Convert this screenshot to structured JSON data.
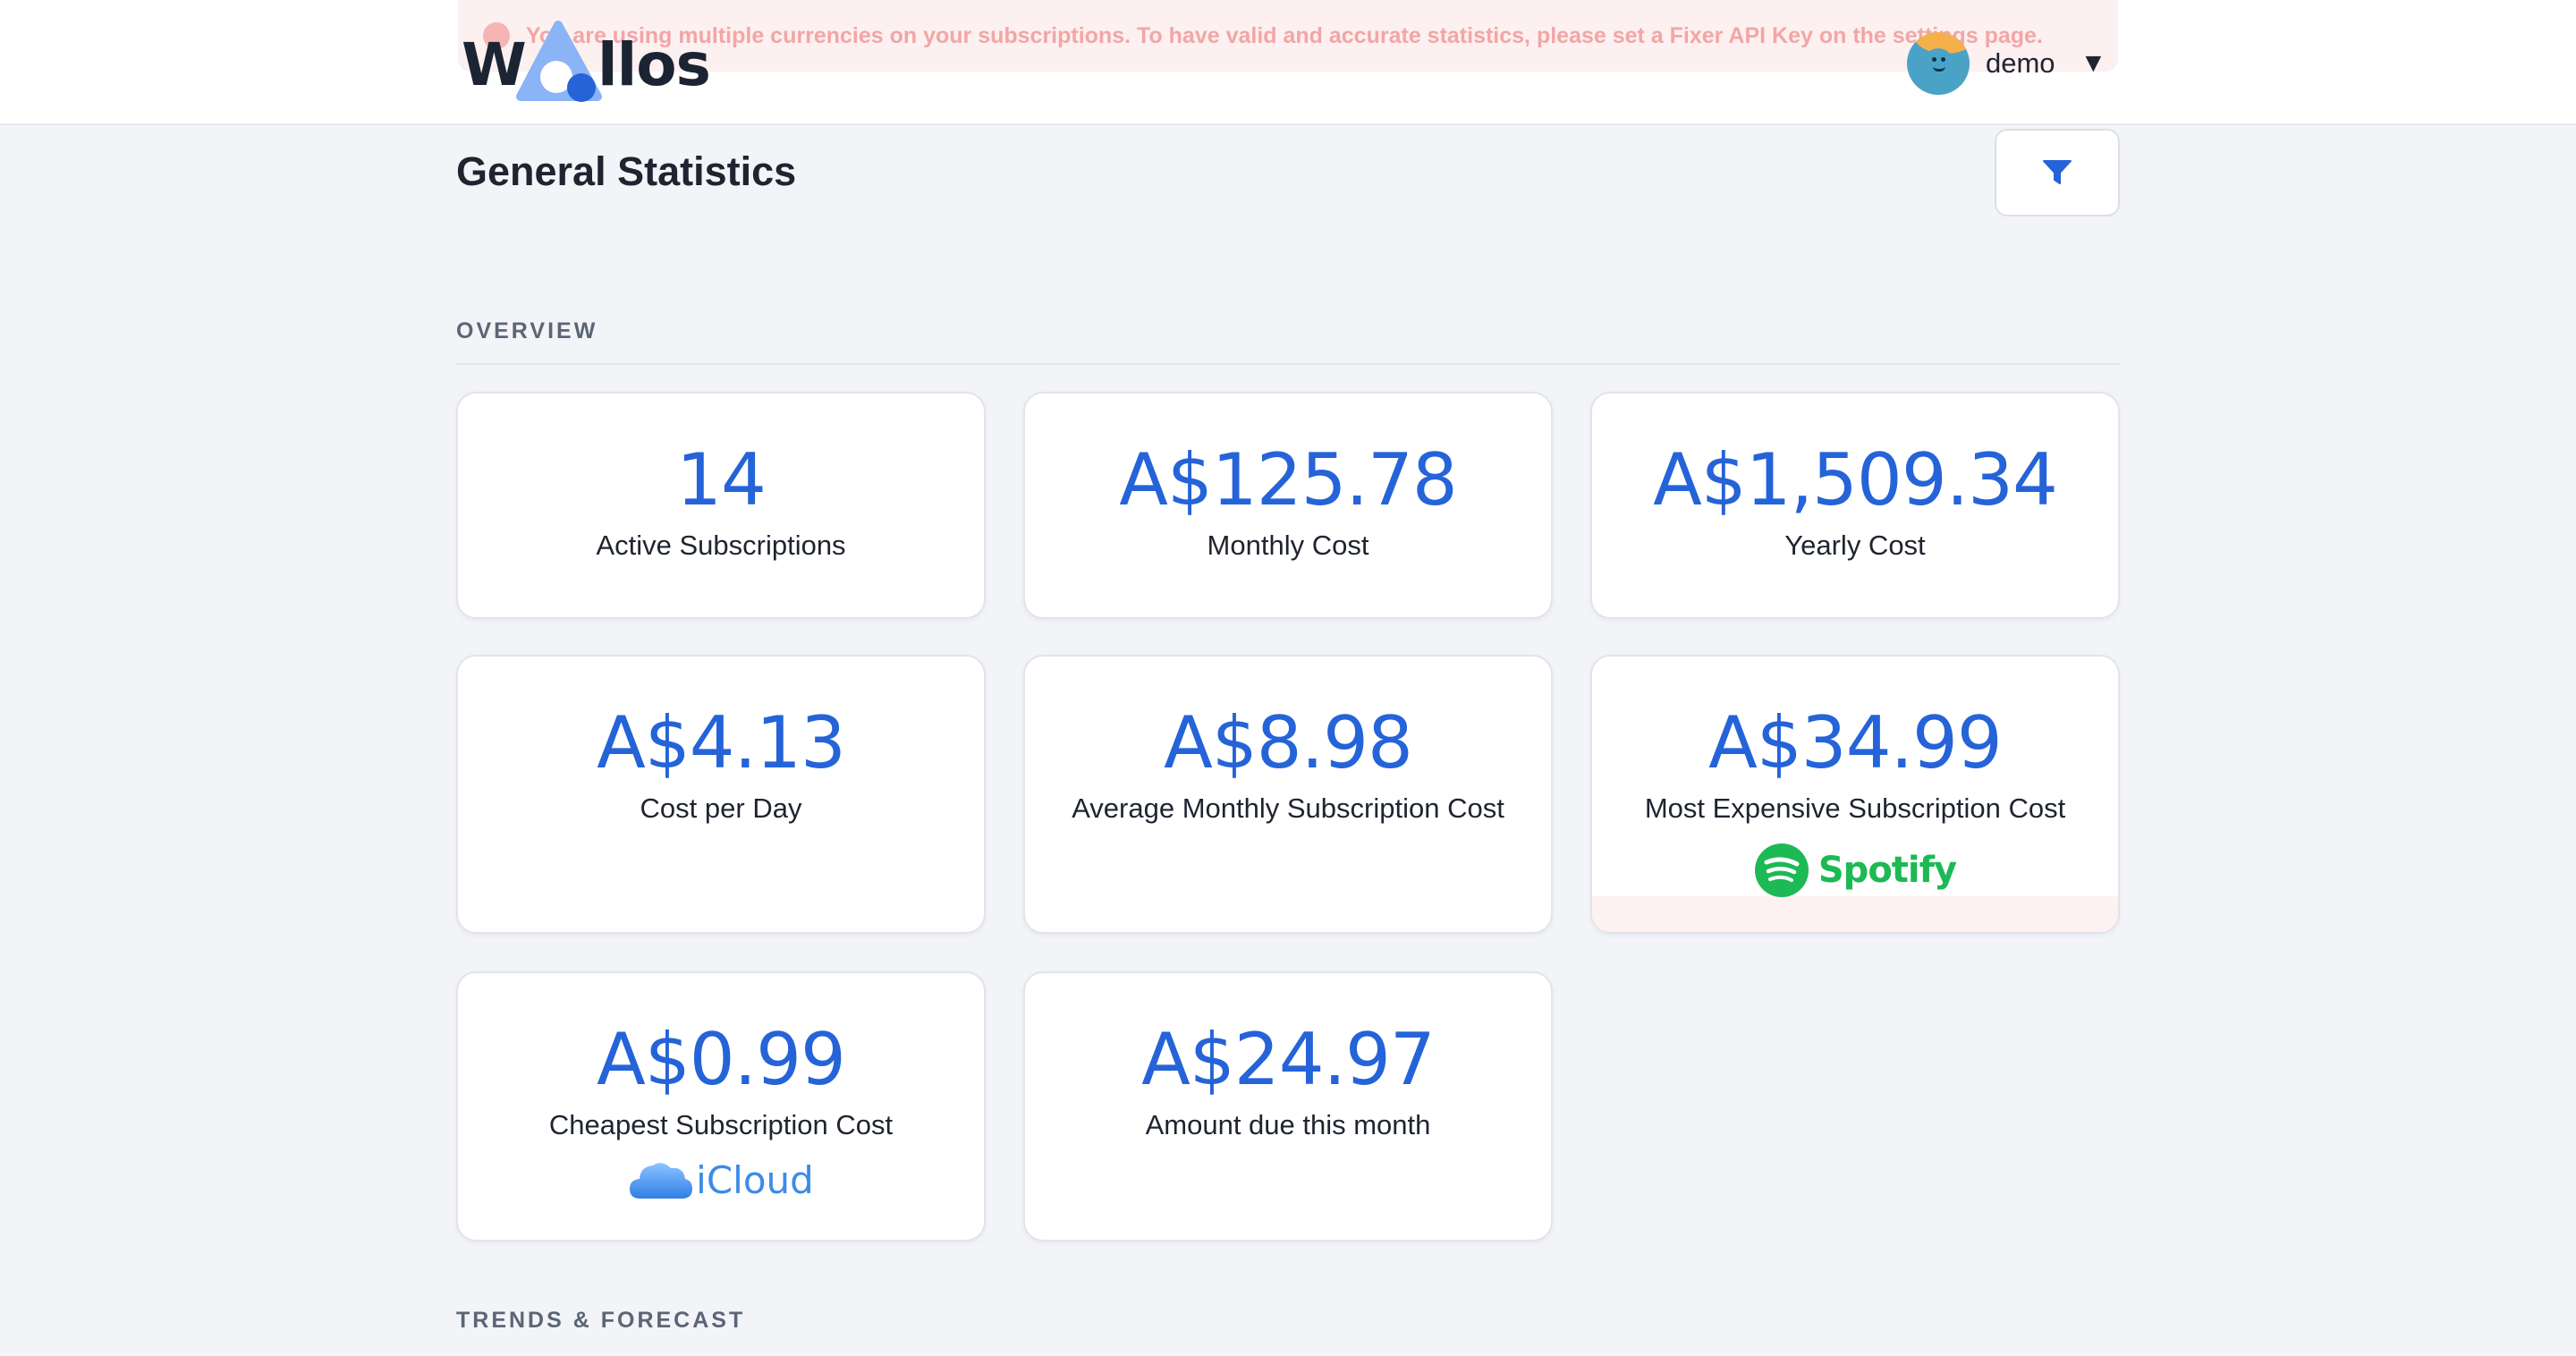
{
  "header": {
    "banner_text": "You are using multiple currencies on your subscriptions. To have valid and accurate statistics, please set a Fixer API Key on the settings page.",
    "logo_w": "W",
    "logo_rest": "llos",
    "user_name": "demo",
    "caret": "▼"
  },
  "page": {
    "title": "General Statistics"
  },
  "sections": {
    "overview": "OVERVIEW",
    "trends": "TRENDS & FORECAST"
  },
  "cards": {
    "active": {
      "value": "14",
      "label": "Active Subscriptions"
    },
    "monthly": {
      "value": "A$125.78",
      "label": "Monthly Cost"
    },
    "yearly": {
      "value": "A$1,509.34",
      "label": "Yearly Cost"
    },
    "per_day": {
      "value": "A$4.13",
      "label": "Cost per Day"
    },
    "average": {
      "value": "A$8.98",
      "label": "Average Monthly Subscription Cost"
    },
    "most_expensive": {
      "value": "A$34.99",
      "label": "Most Expensive Subscription Cost",
      "brand": "Spotify"
    },
    "cheapest": {
      "value": "A$0.99",
      "label": "Cheapest Subscription Cost",
      "brand": "iCloud"
    },
    "due": {
      "value": "A$24.97",
      "label": "Amount due this month"
    }
  },
  "colors": {
    "accent": "#2563d8",
    "spotify": "#1db954",
    "icloud": "#3d8be8",
    "banner_bg": "#fdf0f0"
  },
  "icons": {
    "filter": "filter-icon",
    "warning": "warning-icon",
    "spotify": "spotify-logo-icon",
    "icloud": "icloud-logo-icon"
  }
}
